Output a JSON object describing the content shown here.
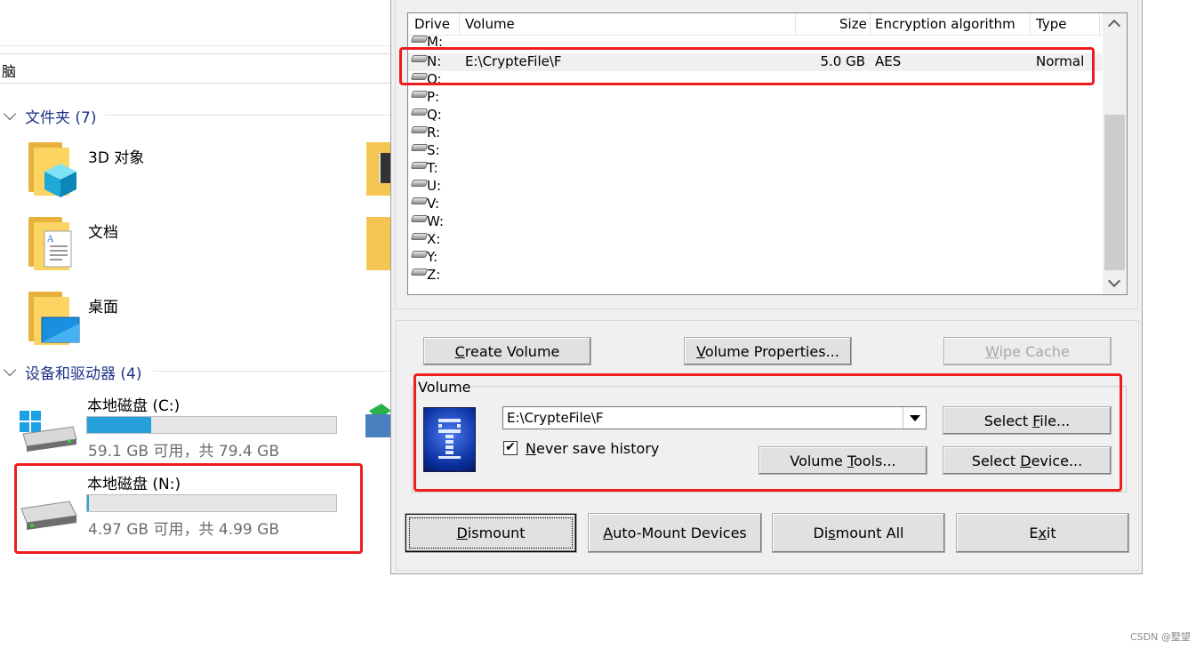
{
  "explorer": {
    "address_fragment": "脑",
    "folders_group": "文件夹 (7)",
    "folders": [
      {
        "label": "3D 对象"
      },
      {
        "label": "文档"
      },
      {
        "label": "桌面"
      }
    ],
    "devices_group": "设备和驱动器 (4)",
    "drives": [
      {
        "name": "本地磁盘 (C:)",
        "free_text": "59.1 GB 可用，共 79.4 GB",
        "used_fraction": 0.256
      },
      {
        "name": "本地磁盘 (N:)",
        "free_text": "4.97 GB 可用，共 4.99 GB",
        "used_fraction": 0.006
      }
    ]
  },
  "veracrypt": {
    "columns": {
      "drive": "Drive",
      "volume": "Volume",
      "size": "Size",
      "algorithm": "Encryption algorithm",
      "type": "Type"
    },
    "rows": [
      {
        "drive": "M:",
        "volume": "",
        "size": "",
        "algorithm": "",
        "type": ""
      },
      {
        "drive": "N:",
        "volume": "E:\\CrypteFile\\F",
        "size": "5.0 GB",
        "algorithm": "AES",
        "type": "Normal"
      },
      {
        "drive": "O:",
        "volume": "",
        "size": "",
        "algorithm": "",
        "type": ""
      },
      {
        "drive": "P:",
        "volume": "",
        "size": "",
        "algorithm": "",
        "type": ""
      },
      {
        "drive": "Q:",
        "volume": "",
        "size": "",
        "algorithm": "",
        "type": ""
      },
      {
        "drive": "R:",
        "volume": "",
        "size": "",
        "algorithm": "",
        "type": ""
      },
      {
        "drive": "S:",
        "volume": "",
        "size": "",
        "algorithm": "",
        "type": ""
      },
      {
        "drive": "T:",
        "volume": "",
        "size": "",
        "algorithm": "",
        "type": ""
      },
      {
        "drive": "U:",
        "volume": "",
        "size": "",
        "algorithm": "",
        "type": ""
      },
      {
        "drive": "V:",
        "volume": "",
        "size": "",
        "algorithm": "",
        "type": ""
      },
      {
        "drive": "W:",
        "volume": "",
        "size": "",
        "algorithm": "",
        "type": ""
      },
      {
        "drive": "X:",
        "volume": "",
        "size": "",
        "algorithm": "",
        "type": ""
      },
      {
        "drive": "Y:",
        "volume": "",
        "size": "",
        "algorithm": "",
        "type": ""
      },
      {
        "drive": "Z:",
        "volume": "",
        "size": "",
        "algorithm": "",
        "type": ""
      }
    ],
    "buttons": {
      "create_volume_pre": "",
      "create_volume_u": "C",
      "create_volume_post": "reate Volume",
      "volume_properties_pre": "",
      "volume_properties_u": "V",
      "volume_properties_post": "olume Properties...",
      "wipe_cache_pre": "",
      "wipe_cache_u": "W",
      "wipe_cache_post": "ipe Cache",
      "select_file_pre": "Select ",
      "select_file_u": "F",
      "select_file_post": "ile...",
      "volume_tools_pre": "Volume ",
      "volume_tools_u": "T",
      "volume_tools_post": "ools...",
      "select_device_pre": "Select ",
      "select_device_u": "D",
      "select_device_post": "evice...",
      "dismount_pre": "",
      "dismount_u": "D",
      "dismount_post": "ismount",
      "auto_mount_pre": "",
      "auto_mount_u": "A",
      "auto_mount_post": "uto-Mount Devices",
      "dismount_all_pre": "Di",
      "dismount_all_u": "s",
      "dismount_all_post": "mount All",
      "exit_pre": "E",
      "exit_u": "x",
      "exit_post": "it"
    },
    "volume_group_label": "Volume",
    "volume_path": "E:\\CrypteFile\\F",
    "never_save_history_pre": "",
    "never_save_history_u": "N",
    "never_save_history_post": "ever save history",
    "never_save_history_checked": true
  },
  "watermark": "CSDN @墅望",
  "highlight_color": "#ee1c1c"
}
